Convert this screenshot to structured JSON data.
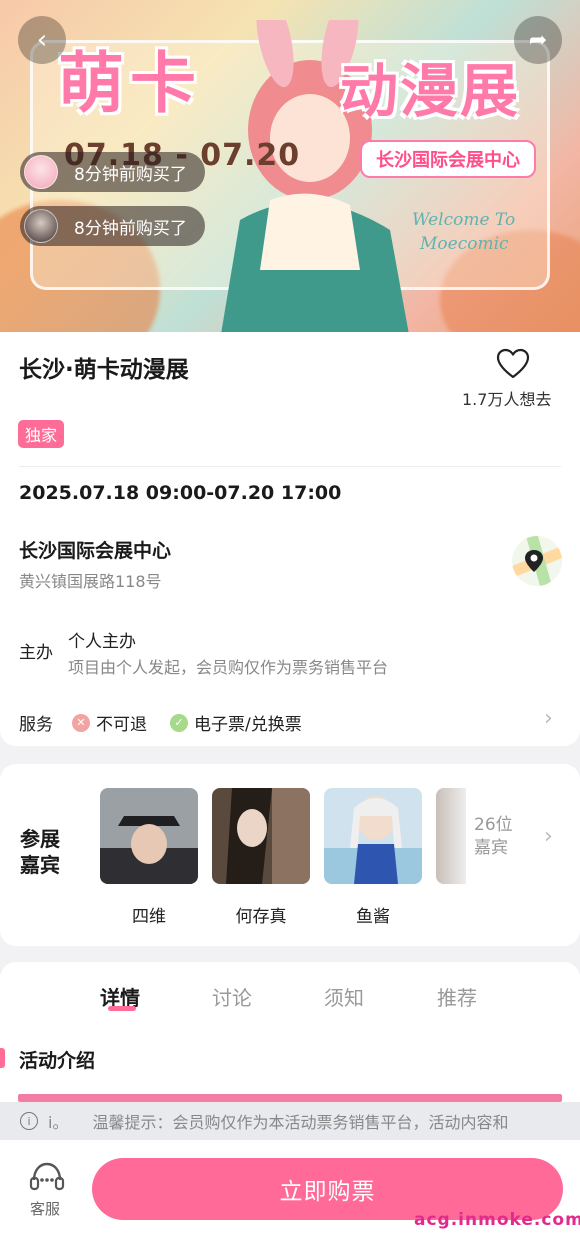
{
  "banner": {
    "title_left": "萌卡",
    "title_right": "动漫展",
    "dates": "07.18 - 07.20",
    "venue_tag": "长沙国际会展中心",
    "welcome_line1": "Welcome To",
    "welcome_line2": "Moecomic"
  },
  "nav": {
    "back_glyph": "‹",
    "share_glyph": "➦"
  },
  "toasts": [
    {
      "text": "8分钟前购买了"
    },
    {
      "text": "8分钟前购买了"
    }
  ],
  "event": {
    "title": "长沙·萌卡动漫展",
    "fav_count": "1.7万人想去",
    "badge": "独家",
    "datetime": "2025.07.18 09:00-07.20 17:00",
    "venue_name": "长沙国际会展中心",
    "venue_address": "黄兴镇国展路118号",
    "organizer_label": "主办",
    "organizer_name": "个人主办",
    "organizer_desc": "项目由个人发起，会员购仅作为票务销售平台",
    "service_label": "服务",
    "services": [
      {
        "label": "不可退",
        "icon": "x-circle-icon",
        "color": "#f4a3a3"
      },
      {
        "label": "电子票/兑换票",
        "icon": "check-circle-icon",
        "color": "#a6d98a"
      }
    ]
  },
  "guests": {
    "title": "参展嘉宾",
    "items": [
      {
        "name": "四维"
      },
      {
        "name": "何存真"
      },
      {
        "name": "鱼酱"
      }
    ],
    "more_count": "26位",
    "more_label": "嘉宾"
  },
  "tabs": [
    {
      "label": "详情",
      "active": true
    },
    {
      "label": "讨论",
      "active": false
    },
    {
      "label": "须知",
      "active": false
    },
    {
      "label": "推荐",
      "active": false
    }
  ],
  "section_title": "活动介绍",
  "notice": {
    "prefix": "i。",
    "text": "温馨提示：会员购仅作为本活动票务销售平台，活动内容和"
  },
  "bottom": {
    "cs_label": "客服",
    "buy_label": "立即购票"
  },
  "watermark": "acg.inmoke.com",
  "colors": {
    "accent": "#ff6a99",
    "badge": "#ff6c98"
  }
}
